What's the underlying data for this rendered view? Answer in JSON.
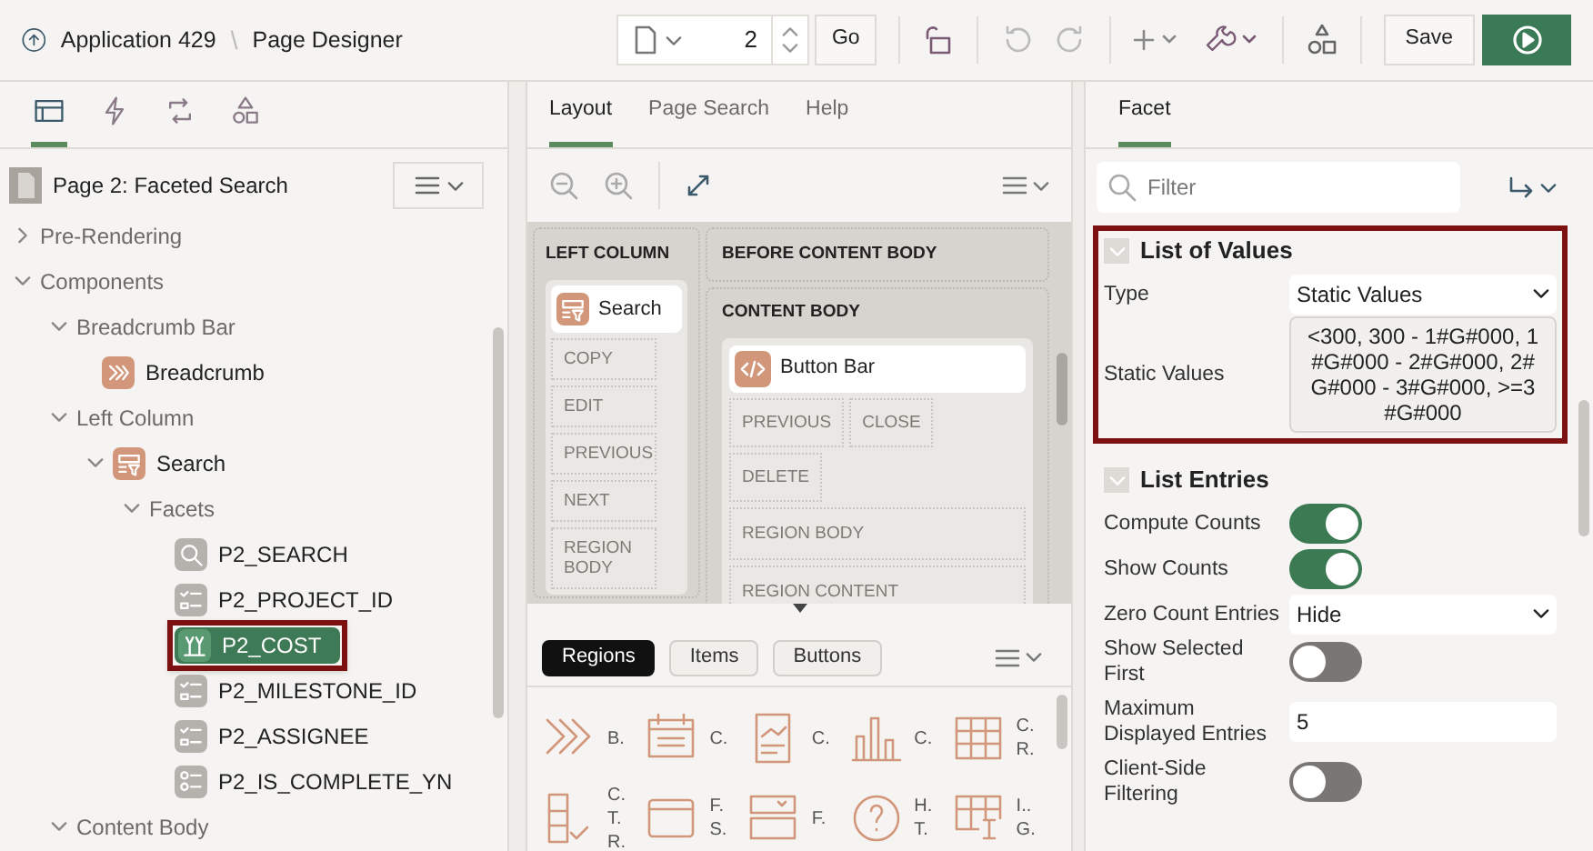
{
  "header": {
    "app": "Application 429",
    "separator": "\\",
    "page_title": "Page Designer",
    "page_number": "2",
    "go": "Go",
    "save": "Save"
  },
  "left_panel": {
    "tabs": [
      {
        "kind": "rendering",
        "selected": true
      },
      {
        "kind": "dynamic",
        "selected": false
      },
      {
        "kind": "processing",
        "selected": false
      },
      {
        "kind": "shared",
        "selected": false
      }
    ],
    "page_label": "Page 2: Faceted Search",
    "tree": [
      {
        "label": "Pre-Rendering",
        "expanded": false,
        "selected": false
      },
      {
        "label": "Components",
        "expanded": true,
        "selected": false,
        "children": [
          {
            "label": "Breadcrumb Bar",
            "expanded": true,
            "selected": false,
            "children": [
              {
                "label": "Breadcrumb",
                "kind": "breadcrumb",
                "selected": false
              }
            ]
          },
          {
            "label": "Left Column",
            "expanded": true,
            "selected": false,
            "children": [
              {
                "label": "Search",
                "kind": "search-region",
                "expanded": true,
                "selected": false,
                "children": [
                  {
                    "label": "Facets",
                    "expanded": true,
                    "selected": false,
                    "children": [
                      {
                        "label": "P2_SEARCH",
                        "kind": "search",
                        "selected": false
                      },
                      {
                        "label": "P2_PROJECT_ID",
                        "kind": "checklist",
                        "selected": false
                      },
                      {
                        "label": "P2_COST",
                        "kind": "range",
                        "selected": true
                      },
                      {
                        "label": "P2_MILESTONE_ID",
                        "kind": "checklist",
                        "selected": false
                      },
                      {
                        "label": "P2_ASSIGNEE",
                        "kind": "checklist",
                        "selected": false
                      },
                      {
                        "label": "P2_IS_COMPLETE_YN",
                        "kind": "radio",
                        "selected": false
                      }
                    ]
                  }
                ]
              }
            ]
          },
          {
            "label": "Content Body",
            "expanded": true,
            "selected": false
          }
        ]
      }
    ]
  },
  "center_panel": {
    "tabs": [
      {
        "label": "Layout",
        "selected": true
      },
      {
        "label": "Page Search",
        "selected": false
      },
      {
        "label": "Help",
        "selected": false
      }
    ],
    "layout": {
      "left_column": {
        "title": "LEFT COLUMN",
        "region": "Search",
        "buttons": [
          "COPY",
          "EDIT",
          "PREVIOUS",
          "NEXT",
          "REGION BODY"
        ]
      },
      "before_content": "BEFORE CONTENT BODY",
      "content_body": {
        "title": "CONTENT BODY",
        "region": "Button Bar",
        "buttons": [
          "PREVIOUS",
          "CLOSE",
          "DELETE"
        ],
        "slots": [
          "REGION BODY",
          "REGION CONTENT"
        ]
      }
    },
    "gallery_tabs": [
      {
        "label": "Regions",
        "selected": true
      },
      {
        "label": "Items",
        "selected": false
      },
      {
        "label": "Buttons",
        "selected": false
      }
    ],
    "gallery": [
      {
        "kind": "breadcrumb",
        "label": "B."
      },
      {
        "kind": "calendar",
        "label": "C."
      },
      {
        "kind": "cards",
        "label": "C."
      },
      {
        "kind": "chart",
        "label": "C."
      },
      {
        "kind": "grid",
        "label": "C. R."
      },
      {
        "kind": "checklist",
        "label": "C. T. R."
      },
      {
        "kind": "frame",
        "label": "F. S."
      },
      {
        "kind": "form",
        "label": "F."
      },
      {
        "kind": "help",
        "label": "H. T."
      },
      {
        "kind": "igrid",
        "label": "I.. G."
      }
    ]
  },
  "right_panel": {
    "tab": "Facet",
    "filter_placeholder": "Filter",
    "groups": [
      {
        "title": "List of Values",
        "highlighted": true,
        "expanded": true,
        "rows": [
          {
            "label": "Type",
            "kind": "select",
            "value": "Static Values"
          },
          {
            "label": "Static Values",
            "kind": "textarea",
            "value": "<300, 300 - 1#G#000, 1#G#000 - 2#G#000, 2#G#000 - 3#G#000, >=3#G#000"
          }
        ]
      },
      {
        "title": "List Entries",
        "highlighted": false,
        "expanded": true,
        "rows": [
          {
            "label": "Compute Counts",
            "kind": "switch",
            "on": true
          },
          {
            "label": "Show Counts",
            "kind": "switch",
            "on": true
          },
          {
            "label": "Zero Count Entries",
            "kind": "select",
            "value": "Hide"
          },
          {
            "label": "Show Selected First",
            "kind": "switch",
            "on": false
          },
          {
            "label": "Maximum Displayed Entries",
            "kind": "text",
            "value": "5"
          },
          {
            "label": "Client-Side Filtering",
            "kind": "switch",
            "on": false
          }
        ]
      }
    ]
  }
}
